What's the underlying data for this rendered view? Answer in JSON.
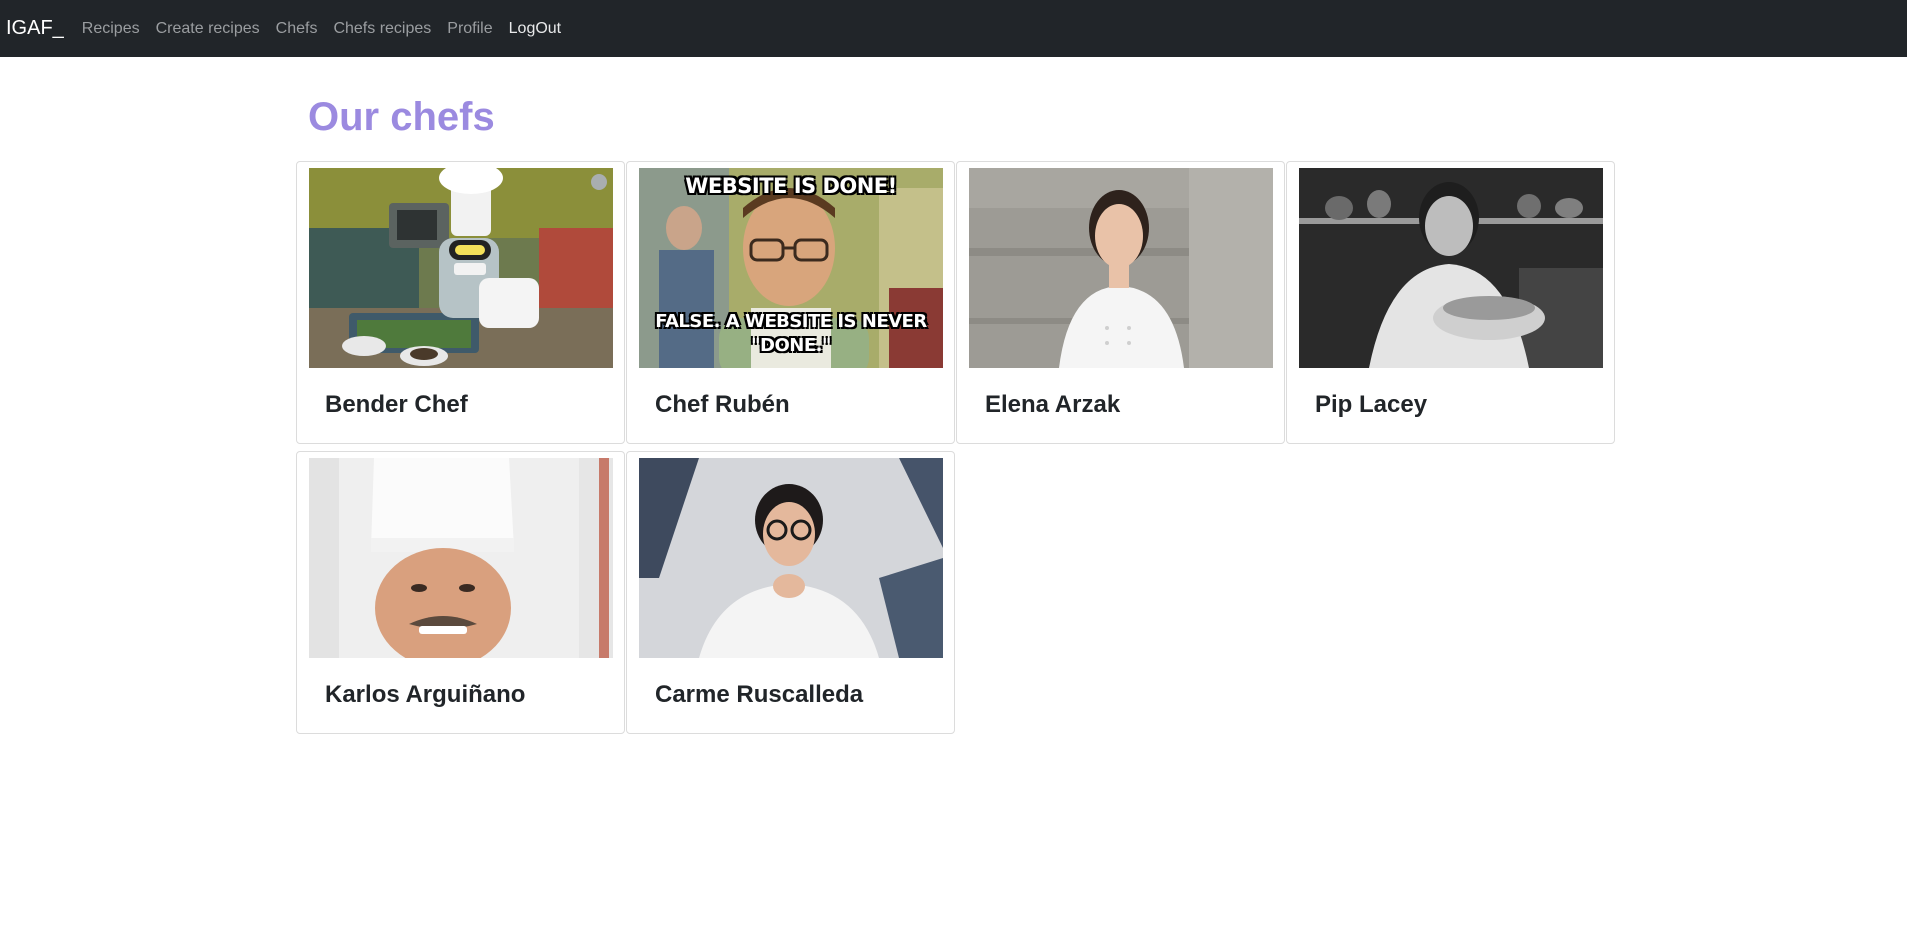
{
  "nav": {
    "brand": "IGAF_",
    "links": [
      "Recipes",
      "Create recipes",
      "Chefs",
      "Chefs recipes",
      "Profile"
    ],
    "logout": "LogOut"
  },
  "page": {
    "title": "Our chefs"
  },
  "chefs": [
    {
      "name": "Bender Chef",
      "image": "robot-chef-illustration"
    },
    {
      "name": "Chef Rubén",
      "image": "meme-photo",
      "meme_top": "WEBSITE IS DONE!",
      "meme_bottom": "FALSE. A WEBSITE IS NEVER \"DONE.\""
    },
    {
      "name": "Elena Arzak",
      "image": "chef-portrait"
    },
    {
      "name": "Pip Lacey",
      "image": "chef-kitchen-bw-photo"
    },
    {
      "name": "Karlos Arguiñano",
      "image": "chef-hat-portrait"
    },
    {
      "name": "Carme Ruscalleda",
      "image": "chef-portrait-glasses"
    }
  ],
  "colors": {
    "navbar": "#212529",
    "title": "#9b8ae0",
    "card_border": "#dcdcdc"
  }
}
